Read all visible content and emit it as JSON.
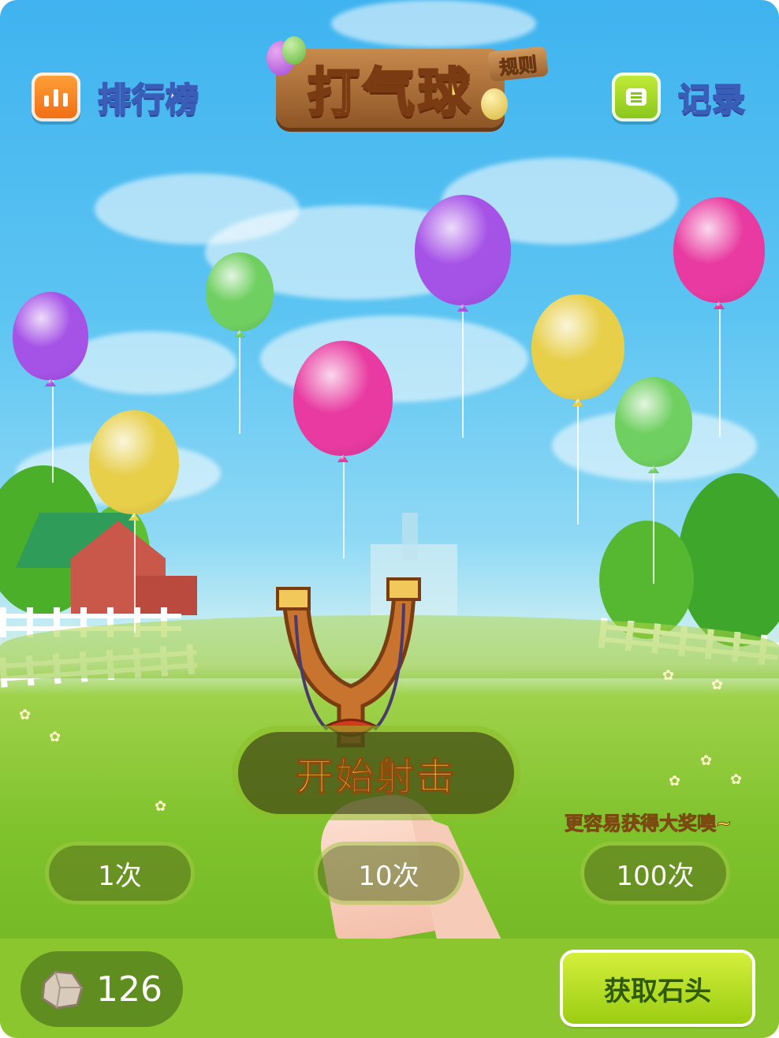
{
  "header": {
    "ranking_label": "排行榜",
    "ranking_icon": "bar-chart-icon",
    "records_label": "记录",
    "records_icon": "list-icon",
    "title": "打气球",
    "rules_label": "规则"
  },
  "balloons": [
    {
      "color": "#a552e6"
    },
    {
      "color": "#6fcf60"
    },
    {
      "color": "#a552e6"
    },
    {
      "color": "#e83aa0"
    },
    {
      "color": "#e7cf4a"
    },
    {
      "color": "#e83aa0"
    },
    {
      "color": "#e7cf4a"
    },
    {
      "color": "#6fcf60"
    }
  ],
  "game": {
    "start_label": "开始射击",
    "hint": "更容易获得大奖噢~",
    "options": [
      "1次",
      "10次",
      "100次"
    ]
  },
  "footer": {
    "stone_count": "126",
    "stone_icon": "stone-icon",
    "get_stone_label": "获取石头"
  },
  "colors": {
    "sky": "#3fb3ef",
    "grass": "#7fc22c",
    "accent_yellow": "#ffe35a",
    "button_green": "#9bcd12"
  }
}
